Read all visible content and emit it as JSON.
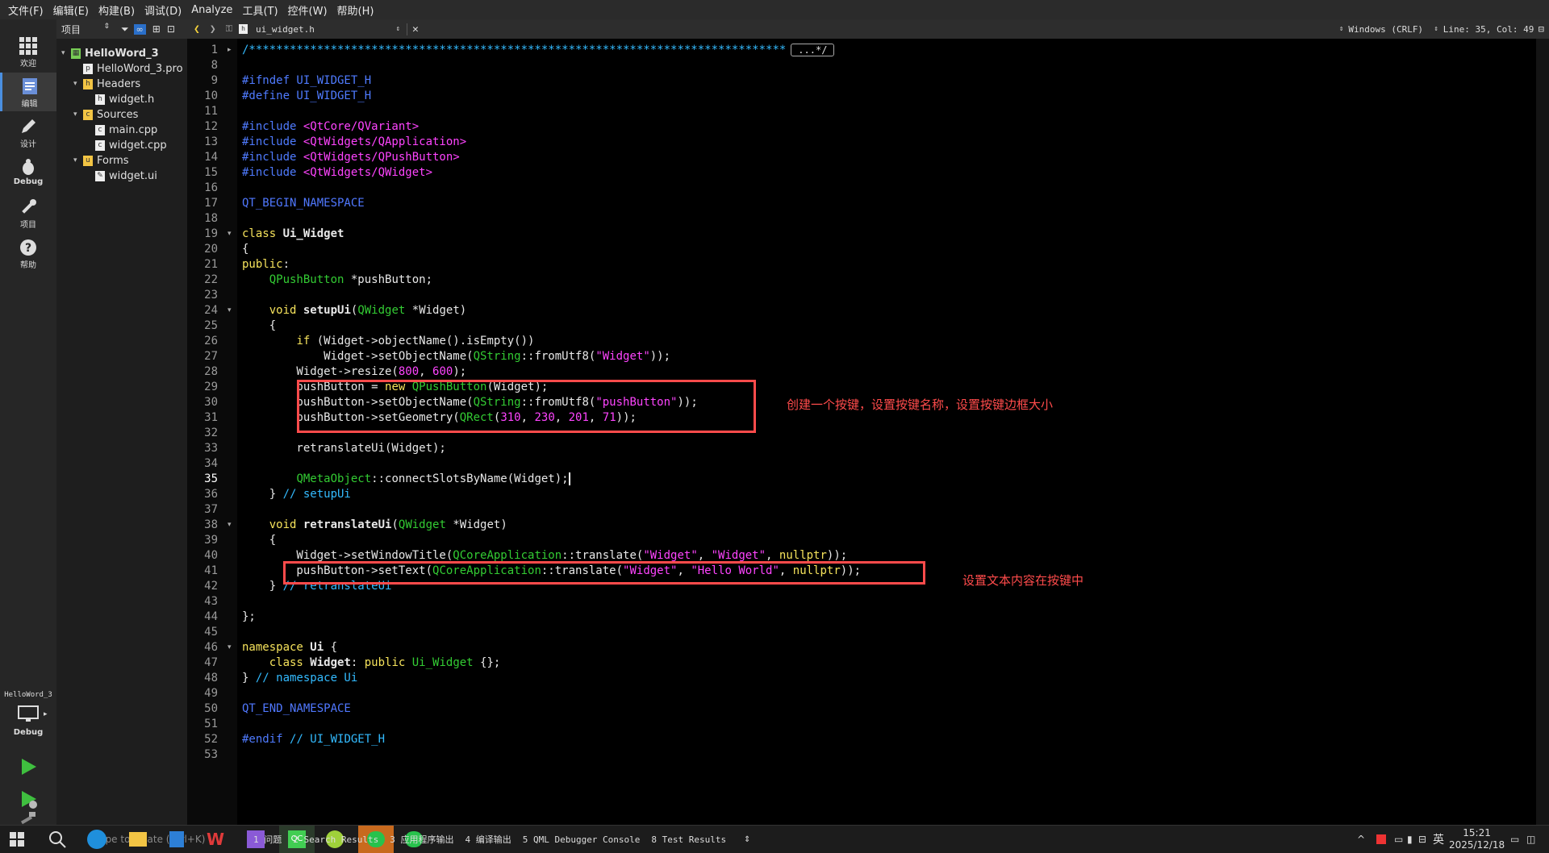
{
  "menu": [
    "文件(F)",
    "编辑(E)",
    "构建(B)",
    "调试(D)",
    "Analyze",
    "工具(T)",
    "控件(W)",
    "帮助(H)"
  ],
  "modes": [
    {
      "label": "欢迎",
      "icon": "grid-icon"
    },
    {
      "label": "编辑",
      "icon": "edit-doc-icon"
    },
    {
      "label": "设计",
      "icon": "pencil-icon"
    },
    {
      "label": "Debug",
      "icon": "bug-icon"
    },
    {
      "label": "项目",
      "icon": "wrench-icon"
    },
    {
      "label": "帮助",
      "icon": "help-icon"
    }
  ],
  "kit": {
    "project": "HelloWord_3",
    "build": "Debug"
  },
  "project_panel": {
    "selector": "项目"
  },
  "tree": [
    {
      "label": "HelloWord_3",
      "level": 0,
      "arrow": "▾",
      "icon": "project-icon"
    },
    {
      "label": "HelloWord_3.pro",
      "level": 1,
      "arrow": "",
      "icon": "pro-file-icon"
    },
    {
      "label": "Headers",
      "level": 1,
      "arrow": "▾",
      "icon": "folder-h-icon"
    },
    {
      "label": "widget.h",
      "level": 2,
      "arrow": "",
      "icon": "header-file-icon"
    },
    {
      "label": "Sources",
      "level": 1,
      "arrow": "▾",
      "icon": "folder-cpp-icon"
    },
    {
      "label": "main.cpp",
      "level": 2,
      "arrow": "",
      "icon": "cpp-file-icon"
    },
    {
      "label": "widget.cpp",
      "level": 2,
      "arrow": "",
      "icon": "cpp-file-icon"
    },
    {
      "label": "Forms",
      "level": 1,
      "arrow": "▾",
      "icon": "folder-ui-icon"
    },
    {
      "label": "widget.ui",
      "level": 2,
      "arrow": "",
      "icon": "ui-file-icon"
    }
  ],
  "editor_toolbar": {
    "filename": "ui_widget.h",
    "line_ending": "Windows (CRLF)",
    "position": "Line: 35, Col: 49"
  },
  "code": [
    {
      "n": "1",
      "fold": "▸",
      "segs": [
        [
          "cm",
          "/*******************************************************************************"
        ],
        [
          "fold",
          "...*/"
        ]
      ]
    },
    {
      "n": "8",
      "segs": []
    },
    {
      "n": "9",
      "segs": [
        [
          "pp",
          "#ifndef UI_WIDGET_H"
        ]
      ]
    },
    {
      "n": "10",
      "segs": [
        [
          "pp",
          "#define UI_WIDGET_H"
        ]
      ]
    },
    {
      "n": "11",
      "segs": []
    },
    {
      "n": "12",
      "segs": [
        [
          "pp",
          "#include "
        ],
        [
          "st",
          "<QtCore/QVariant>"
        ]
      ]
    },
    {
      "n": "13",
      "segs": [
        [
          "pp",
          "#include "
        ],
        [
          "st",
          "<QtWidgets/QApplication>"
        ]
      ]
    },
    {
      "n": "14",
      "segs": [
        [
          "pp",
          "#include "
        ],
        [
          "st",
          "<QtWidgets/QPushButton>"
        ]
      ]
    },
    {
      "n": "15",
      "segs": [
        [
          "pp",
          "#include "
        ],
        [
          "st",
          "<QtWidgets/QWidget>"
        ]
      ]
    },
    {
      "n": "16",
      "segs": []
    },
    {
      "n": "17",
      "segs": [
        [
          "ma",
          "QT_BEGIN_NAMESPACE"
        ]
      ]
    },
    {
      "n": "18",
      "segs": []
    },
    {
      "n": "19",
      "fold": "▾",
      "segs": [
        [
          "kw",
          "class "
        ],
        [
          "fn",
          "Ui_Widget"
        ]
      ]
    },
    {
      "n": "20",
      "segs": [
        [
          "",
          "{"
        ]
      ]
    },
    {
      "n": "21",
      "segs": [
        [
          "kw",
          "public"
        ],
        [
          "",
          ":"
        ]
      ]
    },
    {
      "n": "22",
      "segs": [
        [
          "",
          "    "
        ],
        [
          "ty",
          "QPushButton"
        ],
        [
          "",
          " *pushButton;"
        ]
      ]
    },
    {
      "n": "23",
      "segs": []
    },
    {
      "n": "24",
      "fold": "▾",
      "segs": [
        [
          "",
          "    "
        ],
        [
          "kw",
          "void "
        ],
        [
          "fn",
          "setupUi"
        ],
        [
          "",
          "("
        ],
        [
          "ty",
          "QWidget"
        ],
        [
          "",
          " *Widget)"
        ]
      ]
    },
    {
      "n": "25",
      "segs": [
        [
          "",
          "    {"
        ]
      ]
    },
    {
      "n": "26",
      "segs": [
        [
          "",
          "        "
        ],
        [
          "kw",
          "if"
        ],
        [
          "",
          " (Widget->objectName().isEmpty())"
        ]
      ]
    },
    {
      "n": "27",
      "segs": [
        [
          "",
          "            Widget->setObjectName("
        ],
        [
          "ty",
          "QString"
        ],
        [
          "",
          "::fromUtf8("
        ],
        [
          "st",
          "\"Widget\""
        ],
        [
          "",
          "));"
        ]
      ]
    },
    {
      "n": "28",
      "segs": [
        [
          "",
          "        Widget->resize("
        ],
        [
          "nu",
          "800"
        ],
        [
          "",
          ", "
        ],
        [
          "nu",
          "600"
        ],
        [
          "",
          ");"
        ]
      ]
    },
    {
      "n": "29",
      "segs": [
        [
          "",
          "        pushButton = "
        ],
        [
          "kw",
          "new "
        ],
        [
          "ty",
          "QPushButton"
        ],
        [
          "",
          "(Widget);"
        ]
      ]
    },
    {
      "n": "30",
      "segs": [
        [
          "",
          "        pushButton->setObjectName("
        ],
        [
          "ty",
          "QString"
        ],
        [
          "",
          "::fromUtf8("
        ],
        [
          "st",
          "\"pushButton\""
        ],
        [
          "",
          "));"
        ]
      ]
    },
    {
      "n": "31",
      "segs": [
        [
          "",
          "        pushButton->setGeometry("
        ],
        [
          "ty",
          "QRect"
        ],
        [
          "",
          "("
        ],
        [
          "nu",
          "310"
        ],
        [
          "",
          ", "
        ],
        [
          "nu",
          "230"
        ],
        [
          "",
          ", "
        ],
        [
          "nu",
          "201"
        ],
        [
          "",
          ", "
        ],
        [
          "nu",
          "71"
        ],
        [
          "",
          "));"
        ]
      ]
    },
    {
      "n": "32",
      "segs": []
    },
    {
      "n": "33",
      "segs": [
        [
          "",
          "        retranslateUi(Widget);"
        ]
      ]
    },
    {
      "n": "34",
      "segs": []
    },
    {
      "n": "35",
      "segs": [
        [
          "",
          "        "
        ],
        [
          "ty",
          "QMetaObject"
        ],
        [
          "",
          "::connectSlotsByName(Widget);"
        ]
      ]
    },
    {
      "n": "36",
      "segs": [
        [
          "",
          "    } "
        ],
        [
          "cm",
          "// setupUi"
        ]
      ]
    },
    {
      "n": "37",
      "segs": []
    },
    {
      "n": "38",
      "fold": "▾",
      "segs": [
        [
          "",
          "    "
        ],
        [
          "kw",
          "void "
        ],
        [
          "fn",
          "retranslateUi"
        ],
        [
          "",
          "("
        ],
        [
          "ty",
          "QWidget"
        ],
        [
          "",
          " *Widget)"
        ]
      ]
    },
    {
      "n": "39",
      "segs": [
        [
          "",
          "    {"
        ]
      ]
    },
    {
      "n": "40",
      "segs": [
        [
          "",
          "        Widget->setWindowTitle("
        ],
        [
          "ty",
          "QCoreApplication"
        ],
        [
          "",
          "::translate("
        ],
        [
          "st",
          "\"Widget\""
        ],
        [
          "",
          ", "
        ],
        [
          "st",
          "\"Widget\""
        ],
        [
          "",
          ", "
        ],
        [
          "kw",
          "nullptr"
        ],
        [
          "",
          "));"
        ]
      ]
    },
    {
      "n": "41",
      "segs": [
        [
          "",
          "        pushButton->setText("
        ],
        [
          "ty",
          "QCoreApplication"
        ],
        [
          "",
          "::translate("
        ],
        [
          "st",
          "\"Widget\""
        ],
        [
          "",
          ", "
        ],
        [
          "st",
          "\"Hello World\""
        ],
        [
          "",
          ", "
        ],
        [
          "kw",
          "nullptr"
        ],
        [
          "",
          "));"
        ]
      ]
    },
    {
      "n": "42",
      "segs": [
        [
          "",
          "    } "
        ],
        [
          "cm",
          "// retranslateUi"
        ]
      ]
    },
    {
      "n": "43",
      "segs": []
    },
    {
      "n": "44",
      "segs": [
        [
          "",
          "};"
        ]
      ]
    },
    {
      "n": "45",
      "segs": []
    },
    {
      "n": "46",
      "fold": "▾",
      "segs": [
        [
          "kw",
          "namespace "
        ],
        [
          "fn",
          "Ui"
        ],
        [
          "",
          " {"
        ]
      ]
    },
    {
      "n": "47",
      "segs": [
        [
          "",
          "    "
        ],
        [
          "kw",
          "class "
        ],
        [
          "fn",
          "Widget"
        ],
        [
          "",
          ": "
        ],
        [
          "kw",
          "public "
        ],
        [
          "ty",
          "Ui_Widget"
        ],
        [
          "",
          " {};"
        ]
      ]
    },
    {
      "n": "48",
      "segs": [
        [
          "",
          "} "
        ],
        [
          "cm",
          "// namespace Ui"
        ]
      ]
    },
    {
      "n": "49",
      "segs": []
    },
    {
      "n": "50",
      "segs": [
        [
          "ma",
          "QT_END_NAMESPACE"
        ]
      ]
    },
    {
      "n": "51",
      "segs": []
    },
    {
      "n": "52",
      "segs": [
        [
          "pp",
          "#endif "
        ],
        [
          "cm",
          "// UI_WIDGET_H"
        ]
      ]
    },
    {
      "n": "53",
      "segs": []
    }
  ],
  "current_line": "35",
  "annotations": [
    {
      "text": "创建一个按键，设置按键名称，设置按键边框大小"
    },
    {
      "text": "设置文本内容在按键中"
    }
  ],
  "locator": {
    "placeholder": "Type to locate (Ctrl+K)"
  },
  "output_panes": [
    "1 问题",
    "2 Search Results",
    "3 应用程序输出",
    "4 编译输出",
    "5 QML Debugger Console",
    "8 Test Results"
  ],
  "tray": {
    "time": "15:21",
    "date": "2025/12/18",
    "ime": "英"
  }
}
